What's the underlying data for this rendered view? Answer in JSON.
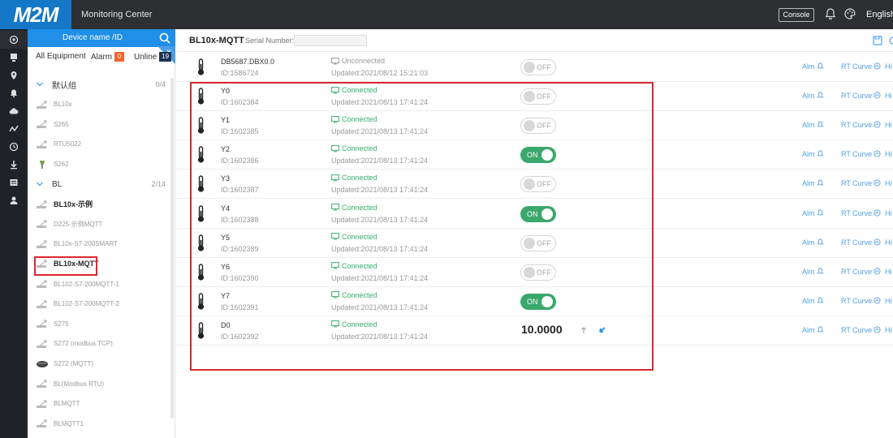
{
  "topbar": {
    "logo": "M2M",
    "title": "Monitoring Center",
    "console_label": "Console",
    "language": "English",
    "icons": [
      "bell-icon",
      "skin-icon"
    ]
  },
  "rail": {
    "icons": [
      "dashboard-icon",
      "equipment-icon",
      "location-icon",
      "alarm-icon",
      "cloud-icon",
      "trend-icon",
      "history-icon",
      "download-icon",
      "report-icon",
      "user-icon"
    ]
  },
  "tree": {
    "search_placeholder": "Device name /ID",
    "tabs": {
      "all": "All Equipment",
      "alarm": "Alarm",
      "alarm_count": "0",
      "online": "Unline",
      "online_count": "19"
    },
    "groups": [
      {
        "name": "默认组",
        "count": "0/4"
      },
      {
        "name": "BL",
        "count": "2/14"
      }
    ],
    "default_devices": [
      "BL10x",
      "S265",
      "RTU5022",
      "S262"
    ],
    "bl_devices": [
      "BL10x-示例",
      "D225-示例MQTT",
      "BL10x-S7-200SMART",
      "BL10x-MQTT",
      "BL102-S7-200MQTT-1",
      "BL102-S7-200MQTT-2",
      "S275",
      "S272 (modbus TCP)",
      "S272 (MQTT)",
      "BL(Modbus RTU)",
      "BLMQTT",
      "BLMQTT1"
    ],
    "selected": "BL10x-MQTT"
  },
  "header": {
    "device": "BL10x-MQTT",
    "serial_label": "Serial Number:"
  },
  "rows": [
    {
      "name": "DB5687.DBX0.0",
      "id": "ID:1586724",
      "conn": "Unconnected",
      "connected": false,
      "updated": "Updated:2021/08/12 15:21:03",
      "state": "OFF"
    },
    {
      "name": "Y0",
      "id": "ID:1602384",
      "conn": "Connected",
      "connected": true,
      "updated": "Updated:2021/08/13 17:41:24",
      "state": "OFF"
    },
    {
      "name": "Y1",
      "id": "ID:1602385",
      "conn": "Connected",
      "connected": true,
      "updated": "Updated:2021/08/13 17:41:24",
      "state": "OFF"
    },
    {
      "name": "Y2",
      "id": "ID:1602386",
      "conn": "Connected",
      "connected": true,
      "updated": "Updated:2021/08/13 17:41:24",
      "state": "ON"
    },
    {
      "name": "Y3",
      "id": "ID:1602387",
      "conn": "Connected",
      "connected": true,
      "updated": "Updated:2021/08/13 17:41:24",
      "state": "OFF"
    },
    {
      "name": "Y4",
      "id": "ID:1602388",
      "conn": "Connected",
      "connected": true,
      "updated": "Updated:2021/08/13 17:41:24",
      "state": "ON"
    },
    {
      "name": "Y5",
      "id": "ID:1602389",
      "conn": "Connected",
      "connected": true,
      "updated": "Updated:2021/08/13 17:41:24",
      "state": "OFF"
    },
    {
      "name": "Y6",
      "id": "ID:1602390",
      "conn": "Connected",
      "connected": true,
      "updated": "Updated:2021/08/13 17:41:24",
      "state": "OFF"
    },
    {
      "name": "Y7",
      "id": "ID:1602391",
      "conn": "Connected",
      "connected": true,
      "updated": "Updated:2021/08/13 17:41:24",
      "state": "ON"
    },
    {
      "name": "D0",
      "id": "ID:1602392",
      "conn": "Connected",
      "connected": true,
      "updated": "Updated:2021/08/13 17:41:24",
      "value": "10.0000"
    }
  ],
  "row_actions": {
    "alarm": "Alm",
    "rt_curve": "RT Curve",
    "history": "Hi"
  },
  "colors": {
    "accent": "#1f8fe8",
    "connected": "#35b06d",
    "on": "#3aa86b",
    "highlight": "#d9282f",
    "topbar": "#2d2f33"
  }
}
